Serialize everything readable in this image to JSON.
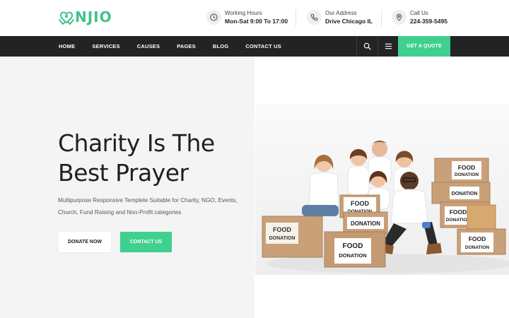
{
  "brand": {
    "name": "NJIO",
    "accent": "#3fd08f",
    "dark": "#222324"
  },
  "header_info": [
    {
      "icon": "clock-icon",
      "label": "Working Hours",
      "value": "Mon-Sat 9:00 To 17:00"
    },
    {
      "icon": "phone-icon",
      "label": "Our Address",
      "value": "Drive Chicago IL"
    },
    {
      "icon": "location-pin-icon",
      "label": "Call Us",
      "value": "224-359-5495"
    }
  ],
  "nav": {
    "items": [
      "HOME",
      "SERVICES",
      "CAUSES",
      "PAGES",
      "BLOG",
      "CONTACT US"
    ],
    "quote_label": "GET A QUOTE"
  },
  "hero": {
    "title_line1": "Charity Is The",
    "title_line2": "Best Prayer",
    "description": "Multipurpose Responsive Templete Suitable for Charity, NGO, Events, Church, Fund Raising and Non-Profit categories",
    "donate_label": "DONATE NOW",
    "contact_label": "CONTACT US"
  },
  "photo": {
    "box_labels": {
      "a": [
        "FOOD",
        "DONATION"
      ],
      "b": [
        "FOOD",
        "DONATION"
      ],
      "c": [
        "DONATION"
      ],
      "d": [
        "FOOD",
        "DONATION"
      ],
      "e": [
        "DONATION"
      ],
      "f": [
        "FOOD",
        "DONATION"
      ],
      "g": [
        "FOOD",
        "DONATION"
      ],
      "h": [
        "FOOD",
        "DONATION"
      ]
    }
  }
}
